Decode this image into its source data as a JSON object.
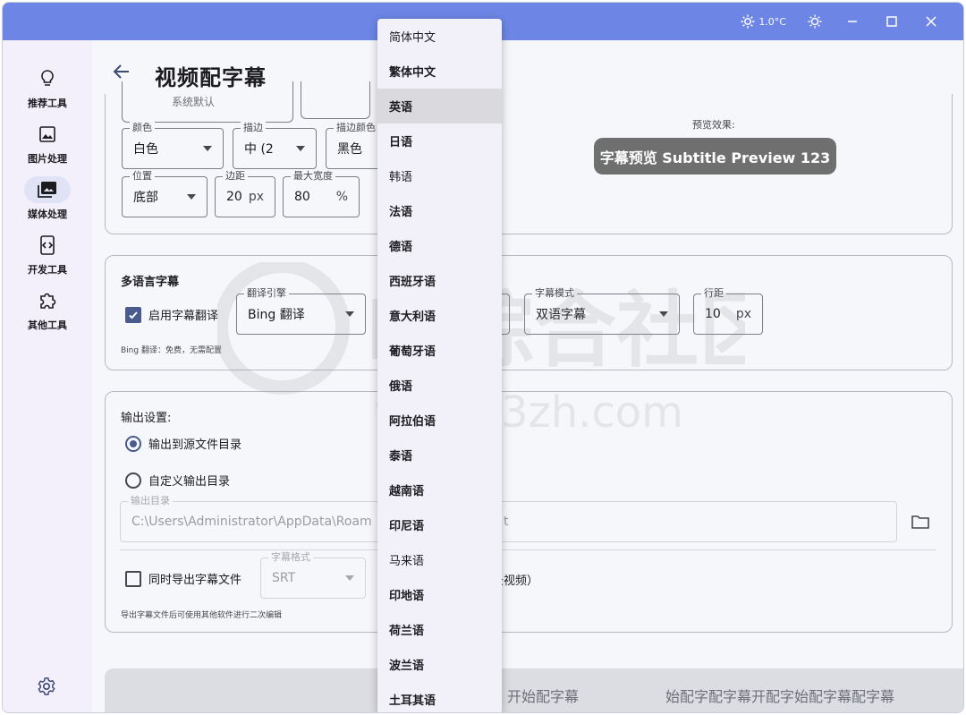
{
  "titlebar": {
    "temperature": "1.0°C"
  },
  "sidebar": {
    "items": [
      {
        "label": "推荐工具",
        "icon": "lightbulb-icon"
      },
      {
        "label": "图片处理",
        "icon": "image-icon"
      },
      {
        "label": "媒体处理",
        "icon": "media-library-icon"
      },
      {
        "label": "开发工具",
        "icon": "code-icon"
      },
      {
        "label": "其他工具",
        "icon": "puzzle-icon"
      }
    ],
    "active_index": 2
  },
  "page": {
    "title": "视频配字幕"
  },
  "style_section": {
    "partial_value": "系统默认",
    "color_label": "颜色",
    "color_value": "白色",
    "stroke_label": "描边",
    "stroke_value": "中 (2",
    "stroke_color_label": "描边颜色",
    "stroke_color_value": "黑色",
    "position_label": "位置",
    "position_value": "底部",
    "margin_label": "边距",
    "margin_value": "20",
    "margin_unit": "px",
    "maxwidth_label": "最大宽度",
    "maxwidth_value": "80",
    "maxwidth_unit": "%",
    "preview_label": "预览效果:",
    "preview_text": "字幕预览 Subtitle Preview 123"
  },
  "multilang": {
    "title": "多语言字幕",
    "enable_label": "启用字幕翻译",
    "enable_checked": true,
    "engine_label": "翻译引擎",
    "engine_value": "Bing 翻译",
    "mode_label": "字幕模式",
    "mode_value": "双语字幕",
    "linespacing_label": "行距",
    "linespacing_value": "10",
    "linespacing_unit": "px",
    "note": "Bing 翻译：免费，无需配置"
  },
  "output": {
    "title": "输出设置:",
    "radio_source": "输出到源文件目录",
    "radio_custom": "自定义输出目录",
    "dir_label": "输出目录",
    "dir_value": "C:\\Users\\Administrator\\AppData\\Roam",
    "dir_value_tail": "t",
    "export_label": "同时导出字幕文件",
    "format_label": "字幕格式",
    "format_value": "SRT",
    "extra_tail": "录视频）",
    "note": "导出字幕文件后可使用其他软件进行二次编辑"
  },
  "start": {
    "label": "开始配字幕",
    "overlay_text": "始配字配字幕开配字始配字幕配字幕"
  },
  "language_dropdown": {
    "items": [
      "简体中文",
      "繁体中文",
      "英语",
      "日语",
      "韩语",
      "法语",
      "德语",
      "西班牙语",
      "意大利语",
      "葡萄牙语",
      "俄语",
      "阿拉伯语",
      "泰语",
      "越南语",
      "印尼语",
      "马来语",
      "印地语",
      "荷兰语",
      "波兰语",
      "土耳其语"
    ],
    "highlighted": "英语"
  },
  "watermark": {
    "text": "IT综合社区",
    "url": "www.i3zh.com"
  },
  "colors": {
    "titlebar": "#6d86e6",
    "sidebar": "#f3effb",
    "accent": "#4a5a8c"
  }
}
